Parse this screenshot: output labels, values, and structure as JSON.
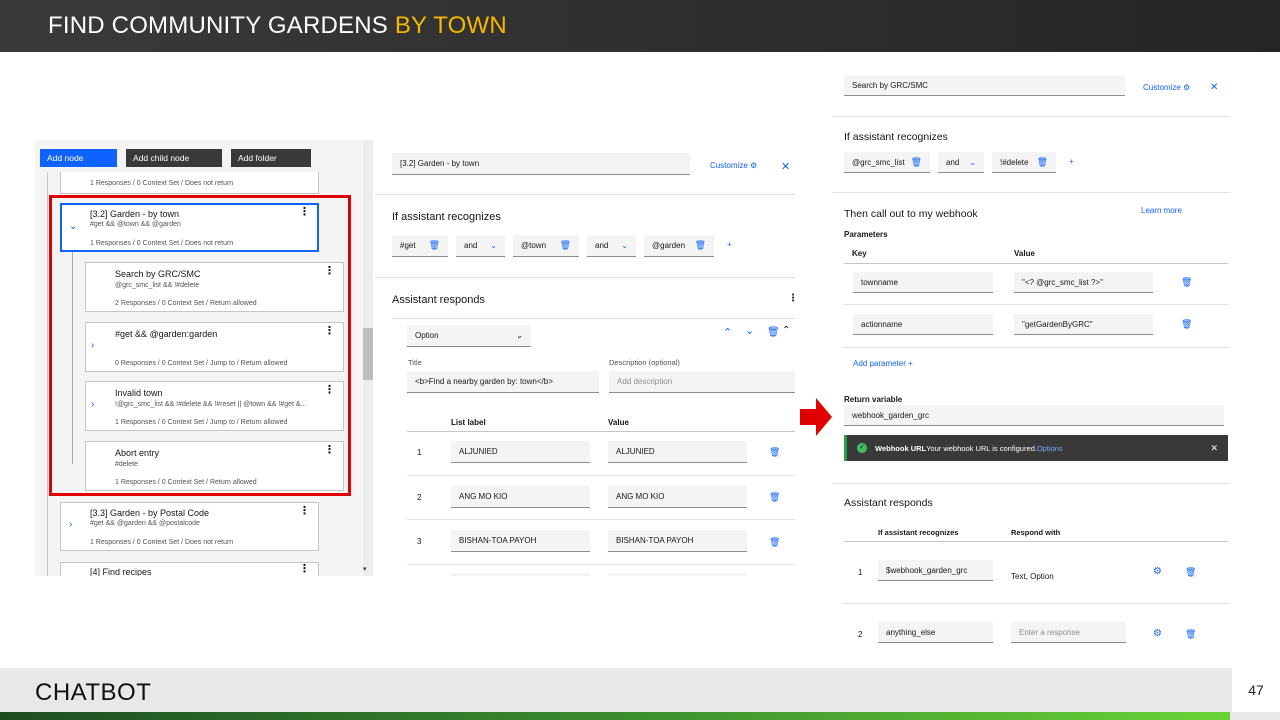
{
  "slide": {
    "title_main": "FIND COMMUNITY GARDENS ",
    "title_highlight": "BY TOWN",
    "footer_label": "CHATBOT",
    "page_number": "47"
  },
  "toolbar": {
    "add_node": "Add node",
    "add_child_node": "Add child node",
    "add_folder": "Add folder"
  },
  "tree": {
    "top_meta": "1 Responses / 0 Context Set / Does not return",
    "garden_town": {
      "title": "[3.2] Garden - by town",
      "condition": "#get && @town && @garden",
      "meta": "1 Responses / 0 Context Set / Does not return"
    },
    "children": [
      {
        "title": "Search by GRC/SMC",
        "condition": "@grc_smc_list && !#delete",
        "meta": "2 Responses / 0 Context Set / Return allowed"
      },
      {
        "title": "#get && @garden:garden",
        "condition": "",
        "meta": "0 Responses / 0 Context Set / Jump to / Return allowed"
      },
      {
        "title": "Invalid town",
        "condition": "!@grc_smc_list && !#delete && !#reset || @town && !#get &...",
        "meta": "1 Responses / 0 Context Set / Jump to / Return allowed"
      },
      {
        "title": "Abort entry",
        "condition": "#delete",
        "meta": "1 Responses / 0 Context Set / Return allowed"
      }
    ],
    "garden_postal": {
      "title": "[3.3] Garden - by Postal Code",
      "condition": "#get && @garden && @postalcode",
      "meta": "1 Responses / 0 Context Set / Does not return"
    },
    "recipes": {
      "title": "[4] Find recipes"
    }
  },
  "editor": {
    "node_name": "[3.2] Garden - by town",
    "customize": "Customize",
    "if_recognizes": "If assistant recognizes",
    "conditions": [
      "#get",
      "@town",
      "@garden"
    ],
    "and": "and",
    "assistant_responds": "Assistant responds",
    "response_type": "Option",
    "title_label": "Title",
    "title_value": "<b>Find a nearby garden by: town</b>",
    "description_label": "Description (optional)",
    "description_placeholder": "Add description",
    "list_label_header": "List label",
    "value_header": "Value",
    "options": [
      {
        "n": "1",
        "label": "ALJUNIED",
        "value": "ALJUNIED"
      },
      {
        "n": "2",
        "label": "ANG MO KIO",
        "value": "ANG MO KIO"
      },
      {
        "n": "3",
        "label": "BISHAN-TOA PAYOH",
        "value": "BISHAN-TOA PAYOH"
      }
    ]
  },
  "right": {
    "node_name": "Search by GRC/SMC",
    "customize": "Customize",
    "if_recognizes": "If assistant recognizes",
    "cond1": "@grc_smc_list",
    "and": "and",
    "cond2": "!#delete",
    "webhook_heading": "Then call out to my webhook",
    "learn_more": "Learn more",
    "parameters": "Parameters",
    "key_header": "Key",
    "value_header": "Value",
    "params": [
      {
        "key": "townname",
        "value": "\"<? @grc_smc_list ?>\""
      },
      {
        "key": "actionname",
        "value": "\"getGardenByGRC\""
      }
    ],
    "add_parameter": "Add parameter",
    "return_variable_label": "Return variable",
    "return_variable": "webhook_garden_grc",
    "banner_bold": "Webhook URL",
    "banner_text": " Your webhook URL is configured. ",
    "banner_link": "Options",
    "assistant_responds": "Assistant responds",
    "col_if": "If assistant recognizes",
    "col_respond": "Respond with",
    "responses": [
      {
        "n": "1",
        "condition": "$webhook_garden_grc",
        "respond": "Text, Option"
      },
      {
        "n": "2",
        "condition": "anything_else",
        "respond_placeholder": "Enter a response"
      }
    ]
  }
}
